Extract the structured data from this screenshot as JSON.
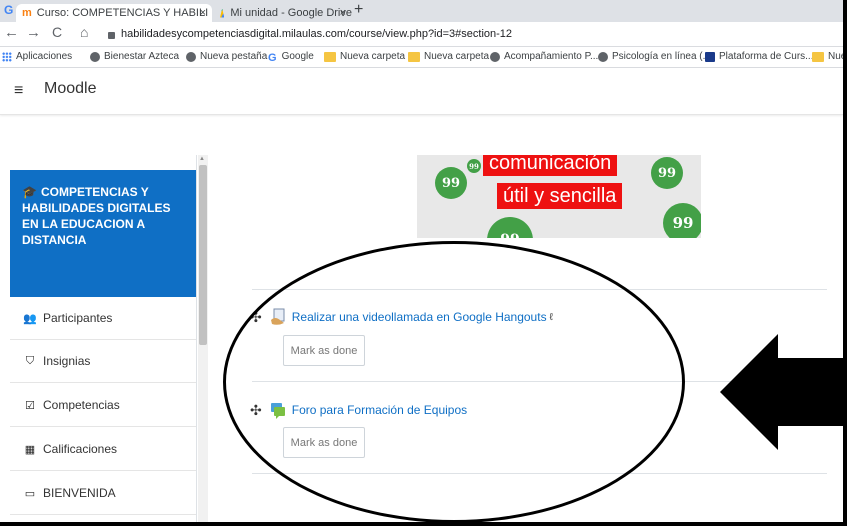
{
  "browser": {
    "tabs": [
      {
        "title": "Curso: COMPETENCIAS Y HABILI",
        "active": true
      },
      {
        "title": "Mi unidad - Google Drive",
        "active": false
      }
    ],
    "close_glyph": "×",
    "newtab_glyph": "+",
    "url": "habilidadesycompetenciasdigital.milaulas.com/course/view.php?id=3#section-12",
    "bookmarks": [
      {
        "label": "Aplicaciones",
        "icon": "apps-icon"
      },
      {
        "label": "Bienestar Azteca",
        "icon": "globe-icon"
      },
      {
        "label": "Nueva pestaña",
        "icon": "globe-icon"
      },
      {
        "label": "Google",
        "icon": "google-icon"
      },
      {
        "label": "Nueva carpeta",
        "icon": "folder-icon"
      },
      {
        "label": "Nueva carpeta",
        "icon": "folder-icon"
      },
      {
        "label": "Acompañamiento P...",
        "icon": "globe-icon"
      },
      {
        "label": "Psicología en línea (...",
        "icon": "globe-icon"
      },
      {
        "label": "Plataforma de Curs...",
        "icon": "platform-icon"
      },
      {
        "label": "Nue",
        "icon": "folder-icon"
      }
    ]
  },
  "moodle": {
    "brand": "Moodle",
    "menu_glyph": "≡"
  },
  "drawer": {
    "course_title": "COMPETENCIAS Y HABILIDADES DIGITALES EN LA EDUCACION A DISTANCIA",
    "items": [
      {
        "label": "Participantes",
        "icon": "users-icon",
        "glyph": "👥"
      },
      {
        "label": "Insignias",
        "icon": "shield-icon",
        "glyph": "⛉"
      },
      {
        "label": "Competencias",
        "icon": "check-square-icon",
        "glyph": "☑"
      },
      {
        "label": "Calificaciones",
        "icon": "table-icon",
        "glyph": "▦"
      },
      {
        "label": "BIENVENIDA",
        "icon": "folder-outline-icon",
        "glyph": "▭"
      }
    ]
  },
  "banner": {
    "line1": "comunicación",
    "line2": "útil y sencilla",
    "quote_glyph": "99"
  },
  "activities": [
    {
      "title": "Realizar una videollamada en Google Hangouts",
      "suffix": "ℓ",
      "icon": "url-icon",
      "button": "Mark as done"
    },
    {
      "title": "Foro para Formación de Equipos",
      "suffix": "",
      "icon": "forum-icon",
      "button": "Mark as done"
    }
  ],
  "colors": {
    "course_highlight": "#0f6fc5",
    "link": "#0f6fc5",
    "banner_red": "#ee1111",
    "banner_green": "#43a047"
  }
}
